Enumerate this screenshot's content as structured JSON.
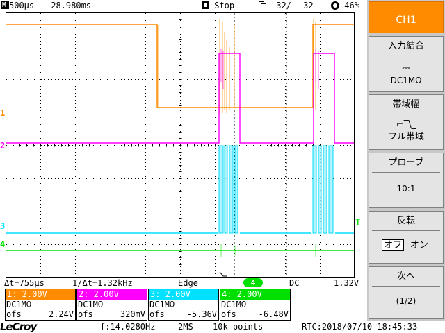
{
  "topbar": {
    "timebase": "500µs",
    "delay": "-28.980ms",
    "run_state": "Stop",
    "acquisitions": "32/",
    "acquisitions_total": "32",
    "intensity": "46%"
  },
  "channels": [
    {
      "id": "1",
      "color": "#ff8c00",
      "header": "1: 2.00V",
      "coupling": "DC1MΩ",
      "ofs_label": "ofs",
      "ofs_value": "2.24V"
    },
    {
      "id": "2",
      "color": "#ff00ff",
      "header": "2: 2.00V",
      "coupling": "DC1MΩ",
      "ofs_label": "ofs",
      "ofs_value": "320mV"
    },
    {
      "id": "3",
      "color": "#00e0ff",
      "header": "3: 2.00V",
      "coupling": "DC1MΩ",
      "ofs_label": "ofs",
      "ofs_value": "-5.36V"
    },
    {
      "id": "4",
      "color": "#00e000",
      "header": "4: 2.00V",
      "coupling": "DC1MΩ",
      "ofs_label": "ofs",
      "ofs_value": "-6.48V"
    }
  ],
  "markers": {
    "ch1": "1",
    "ch2": "2",
    "ch3": "3",
    "ch4": "4",
    "trigger_level": "T"
  },
  "measure": {
    "delta_t": "Δt=755µs",
    "inv_delta_t": "1/Δt=1.32kHz",
    "trigger_type": "Edge",
    "trigger_source": "4",
    "trigger_coupling": "DC",
    "trigger_level": "1.32V"
  },
  "footer": {
    "brand": "LeCroy",
    "frequency": "f:14.0280Hz",
    "sample_rate": "2MS",
    "record_length": "10k points",
    "rtc": "RTC:2018/07/10 18:45:33"
  },
  "menu": {
    "ch1": "CH1",
    "input_coupling_title": "入力結合",
    "input_coupling_symbol": "⎓",
    "input_coupling_value": "DC1MΩ",
    "bandwidth_title": "帯域幅",
    "bandwidth_value": "フル帯域",
    "probe_title": "プローブ",
    "probe_value": "10:1",
    "invert_title": "反転",
    "invert_off": "オフ",
    "invert_on": "オン",
    "next_title": "次へ",
    "next_page": "(1/2)"
  },
  "colors": {
    "ch1": "#ff8c00",
    "ch2": "#ff00ff",
    "ch3": "#00e0ff",
    "ch4": "#00e000",
    "menu_active": "#ff8c00",
    "menu_bg": "#c8c8c8"
  }
}
